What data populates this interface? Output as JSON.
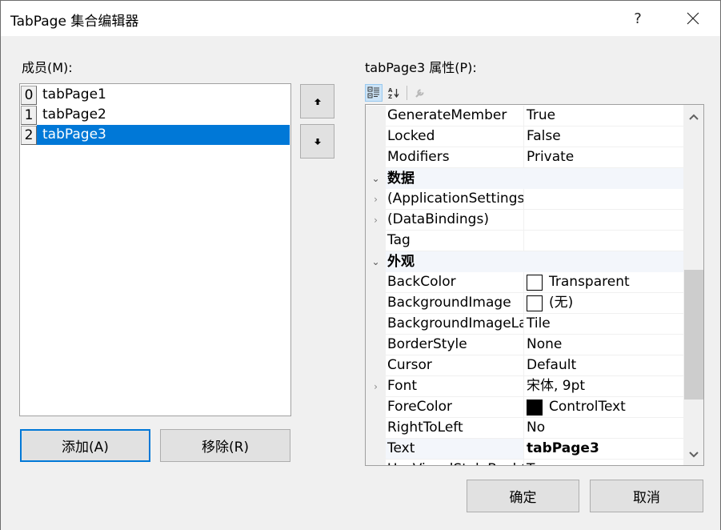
{
  "window": {
    "title": "TabPage 集合编辑器",
    "help_label": "?",
    "close_label": "✕"
  },
  "members": {
    "label": "成员(M):",
    "items": [
      {
        "index": "0",
        "name": "tabPage1",
        "selected": false
      },
      {
        "index": "1",
        "name": "tabPage2",
        "selected": false
      },
      {
        "index": "2",
        "name": "tabPage3",
        "selected": true
      }
    ],
    "move_up_icon": "▲",
    "move_down_icon": "▼",
    "add_label": "添加(A)",
    "remove_label": "移除(R)"
  },
  "properties": {
    "label": "tabPage3 属性(P):",
    "toolbar": {
      "categorized": "categorized-icon",
      "alphabetical": "alphabetical-icon",
      "property_pages": "property-pages-icon"
    },
    "rows": [
      {
        "type": "prop",
        "name": "GenerateMember",
        "value": "True"
      },
      {
        "type": "prop",
        "name": "Locked",
        "value": "False"
      },
      {
        "type": "prop",
        "name": "Modifiers",
        "value": "Private"
      },
      {
        "type": "category",
        "name": "数据"
      },
      {
        "type": "prop",
        "name": "(ApplicationSettings)",
        "value": "",
        "expandable": true
      },
      {
        "type": "prop",
        "name": "(DataBindings)",
        "value": "",
        "expandable": true
      },
      {
        "type": "prop",
        "name": "Tag",
        "value": ""
      },
      {
        "type": "category",
        "name": "外观"
      },
      {
        "type": "prop",
        "name": "BackColor",
        "value": "Transparent",
        "swatch": "#ffffff"
      },
      {
        "type": "prop",
        "name": "BackgroundImage",
        "value": "(无)",
        "swatch": "#ffffff"
      },
      {
        "type": "prop",
        "name": "BackgroundImageLayout",
        "value": "Tile"
      },
      {
        "type": "prop",
        "name": "BorderStyle",
        "value": "None"
      },
      {
        "type": "prop",
        "name": "Cursor",
        "value": "Default"
      },
      {
        "type": "prop",
        "name": "Font",
        "value": "宋体, 9pt",
        "expandable": true
      },
      {
        "type": "prop",
        "name": "ForeColor",
        "value": "ControlText",
        "swatch": "#000000"
      },
      {
        "type": "prop",
        "name": "RightToLeft",
        "value": "No"
      },
      {
        "type": "prop",
        "name": "Text",
        "value": "tabPage3",
        "bold": true,
        "selected": true
      },
      {
        "type": "prop",
        "name": "UseVisualStyleBackColor",
        "value": "True"
      }
    ]
  },
  "footer": {
    "ok_label": "确定",
    "cancel_label": "取消"
  },
  "colors": {
    "accent": "#0078d7",
    "selection_bg": "#0078d7",
    "category_bg": "#f3f6fb",
    "button_bg": "#e1e1e1"
  }
}
